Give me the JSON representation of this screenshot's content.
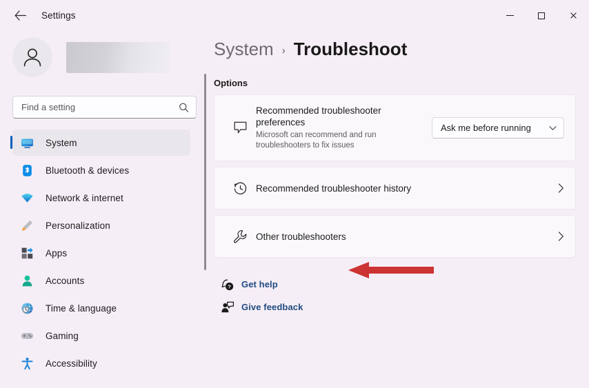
{
  "window": {
    "app_title": "Settings",
    "back_icon": "back-arrow-icon",
    "minimize_label": "—",
    "maximize_label": "□",
    "close_label": "✕"
  },
  "sidebar": {
    "account_name": "",
    "avatar_icon": "person-avatar-icon",
    "search": {
      "placeholder": "Find a setting",
      "value": "",
      "icon": "search-icon"
    },
    "items": [
      {
        "label": "System",
        "icon": "monitor-icon",
        "selected": true
      },
      {
        "label": "Bluetooth & devices",
        "icon": "bluetooth-icon",
        "selected": false
      },
      {
        "label": "Network & internet",
        "icon": "wifi-icon",
        "selected": false
      },
      {
        "label": "Personalization",
        "icon": "paintbrush-icon",
        "selected": false
      },
      {
        "label": "Apps",
        "icon": "apps-grid-icon",
        "selected": false
      },
      {
        "label": "Accounts",
        "icon": "person-icon",
        "selected": false
      },
      {
        "label": "Time & language",
        "icon": "clock-globe-icon",
        "selected": false
      },
      {
        "label": "Gaming",
        "icon": "gamepad-icon",
        "selected": false
      },
      {
        "label": "Accessibility",
        "icon": "accessibility-icon",
        "selected": false
      }
    ]
  },
  "content": {
    "breadcrumb": {
      "parent": "System",
      "separator": "›",
      "current": "Troubleshoot"
    },
    "section_label": "Options",
    "cards": [
      {
        "title": "Recommended troubleshooter preferences",
        "subtitle": "Microsoft can recommend and run troubleshooters to fix issues",
        "icon": "speech-bubble-icon",
        "control": "dropdown",
        "dropdown_value": "Ask me before running",
        "dropdown_icon": "chevron-down-icon"
      },
      {
        "title": "Recommended troubleshooter history",
        "icon": "clock-history-icon",
        "control": "chevron",
        "chevron_icon": "chevron-right-icon"
      },
      {
        "title": "Other troubleshooters",
        "icon": "wrench-icon",
        "control": "chevron",
        "chevron_icon": "chevron-right-icon"
      }
    ],
    "links": [
      {
        "label": "Get help",
        "icon": "help-question-icon"
      },
      {
        "label": "Give feedback",
        "icon": "feedback-person-icon"
      }
    ]
  },
  "annotation": {
    "arrow_color": "#cc3333",
    "arrow_target": "Other troubleshooters"
  },
  "colors": {
    "page_background": "#f6eef6",
    "card_background": "#fbf8fc",
    "accent": "#005fb8",
    "link": "#1f4b82",
    "selection": "#e9e6ec"
  }
}
